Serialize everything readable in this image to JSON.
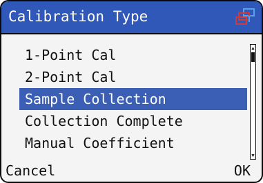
{
  "header": {
    "title": "Calibration Type",
    "icon": "network-icon",
    "colors": {
      "bar": "#2f58b8",
      "icon_blue": "#5aa0e8",
      "icon_red": "#d23a3a"
    }
  },
  "menu": {
    "items": [
      {
        "label": "1-Point Cal",
        "selected": false
      },
      {
        "label": "2-Point Cal",
        "selected": false
      },
      {
        "label": "Sample Collection",
        "selected": true
      },
      {
        "label": "Collection Complete",
        "selected": false
      },
      {
        "label": "Manual Coefficient",
        "selected": false
      }
    ],
    "selection_color": "#3b5fb5"
  },
  "softkeys": {
    "left": "Cancel",
    "right": "OK"
  }
}
